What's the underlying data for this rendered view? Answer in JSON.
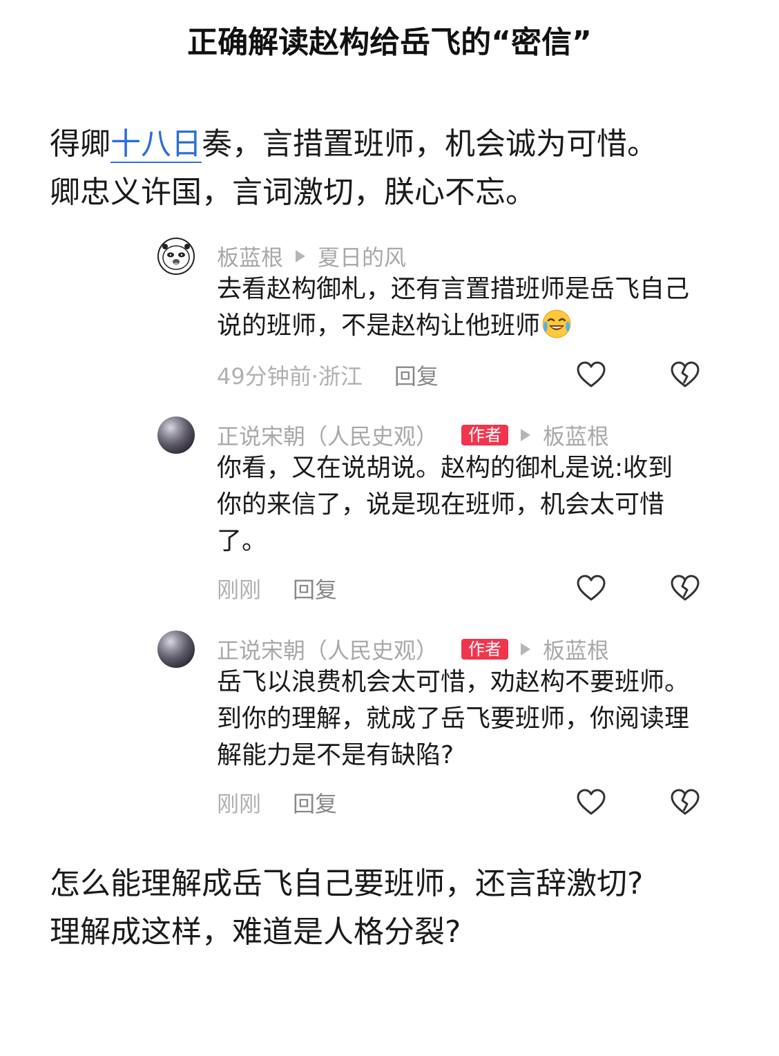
{
  "title": "正确解读赵构给岳飞的“密信”",
  "quote": {
    "line1_before": "得卿",
    "line1_highlight": "十八日",
    "line1_after": "奏，言措置班师，机会诚为可惜。",
    "line2": "卿忠义许国，言词激切，朕心不忘。"
  },
  "comments": [
    {
      "user": "板蓝根",
      "reply_to": "夏日的风",
      "badge": "",
      "text": "去看赵构御札，还有言置措班师是岳飞自己说的班师，不是赵构让他班师",
      "emoji": "crying-laughing-emoji",
      "time": "49分钟前·浙江",
      "reply_label": "回复"
    },
    {
      "user": "正说宋朝（人民史观）",
      "reply_to": "板蓝根",
      "badge": "作者",
      "text": "你看，又在说胡说。赵构的御札是说:收到你的来信了，说是现在班师，机会太可惜了。",
      "time": "刚刚",
      "reply_label": "回复"
    },
    {
      "user": "正说宋朝（人民史观）",
      "reply_to": "板蓝根",
      "badge": "作者",
      "text": "岳飞以浪费机会太可惜，劝赵构不要班师。到你的理解，就成了岳飞要班师，你阅读理解能力是不是有缺陷?",
      "time": "刚刚",
      "reply_label": "回复"
    }
  ],
  "outro": {
    "line1": "怎么能理解成岳飞自己要班师，还言辞激切?",
    "line2": "理解成这样，难道是人格分裂?"
  },
  "colors": {
    "highlight": "#2a6fd6",
    "badge": "#f0354d",
    "meta_text": "#b0b0b0"
  }
}
